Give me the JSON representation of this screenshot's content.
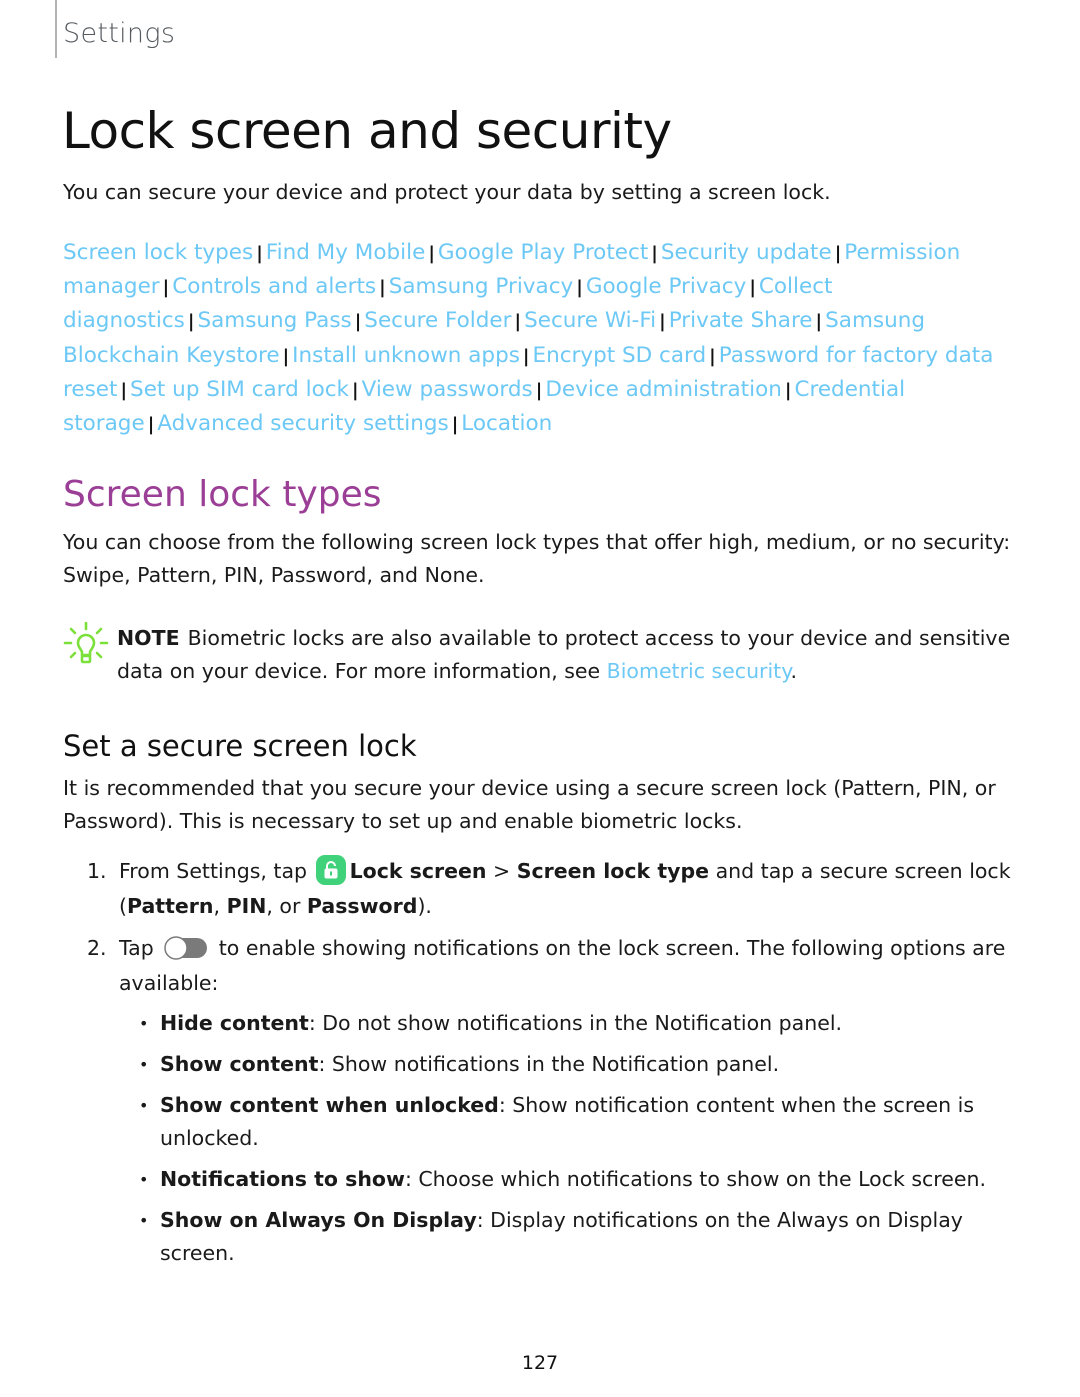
{
  "header": {
    "section_label": "Settings"
  },
  "page": {
    "title": "Lock screen and security",
    "intro": "You can secure your device and protect your data by setting a screen lock.",
    "links": [
      "Screen lock types",
      "Find My Mobile",
      "Google Play Protect",
      "Security update",
      "Permission manager",
      "Controls and alerts",
      "Samsung Privacy",
      "Google Privacy",
      "Collect diagnostics",
      "Samsung Pass",
      "Secure Folder",
      "Secure Wi-Fi",
      "Private Share",
      "Samsung Blockchain Keystore",
      "Install unknown apps",
      "Encrypt SD card",
      "Password for factory data reset",
      "Set up SIM card lock",
      "View passwords",
      "Device administration",
      "Credential storage",
      "Advanced security settings",
      "Location"
    ],
    "link_separator": "|",
    "page_number": "127"
  },
  "section": {
    "title": "Screen lock types",
    "body": "You can choose from the following screen lock types that offer high, medium, or no security: Swipe, Pattern, PIN, Password, and None.",
    "note": {
      "label": "NOTE",
      "text": "Biometric locks are also available to protect access to your device and sensitive data on your device. For more information, see ",
      "link": "Biometric security",
      "end": "."
    }
  },
  "subsection": {
    "title": "Set a secure screen lock",
    "body": "It is recommended that you secure your device using a secure screen lock (Pattern, PIN, or Password). This is necessary to set up and enable biometric locks.",
    "steps": [
      {
        "num": "1.",
        "pre": "From Settings, tap ",
        "menu1": "Lock screen",
        "arrow": " > ",
        "menu2": "Screen lock type",
        "mid": " and tap a secure screen lock (",
        "opt1": "Pattern",
        "c1": ", ",
        "opt2": "PIN",
        "c2": ", or ",
        "opt3": "Password",
        "end": ")."
      },
      {
        "num": "2.",
        "pre": "Tap ",
        "post": " to enable showing notifications on the lock screen. The following options are available:",
        "bullets": [
          {
            "term": "Hide content",
            "desc": ": Do not show notifications in the Notification panel."
          },
          {
            "term": "Show content",
            "desc": ": Show notifications in the Notification panel."
          },
          {
            "term": "Show content when unlocked",
            "desc": ": Show notification content when the screen is unlocked."
          },
          {
            "term": "Notifications to show",
            "desc": ": Choose which notifications to show on the Lock screen."
          },
          {
            "term": "Show on Always On Display",
            "desc": ": Display notifications on the Always on Display screen."
          }
        ]
      }
    ]
  },
  "colors": {
    "link": "#6cc8f5",
    "section_title": "#9b3e96",
    "note_icon": "#7ce03a",
    "lock_app_icon": "#3fd27a"
  }
}
